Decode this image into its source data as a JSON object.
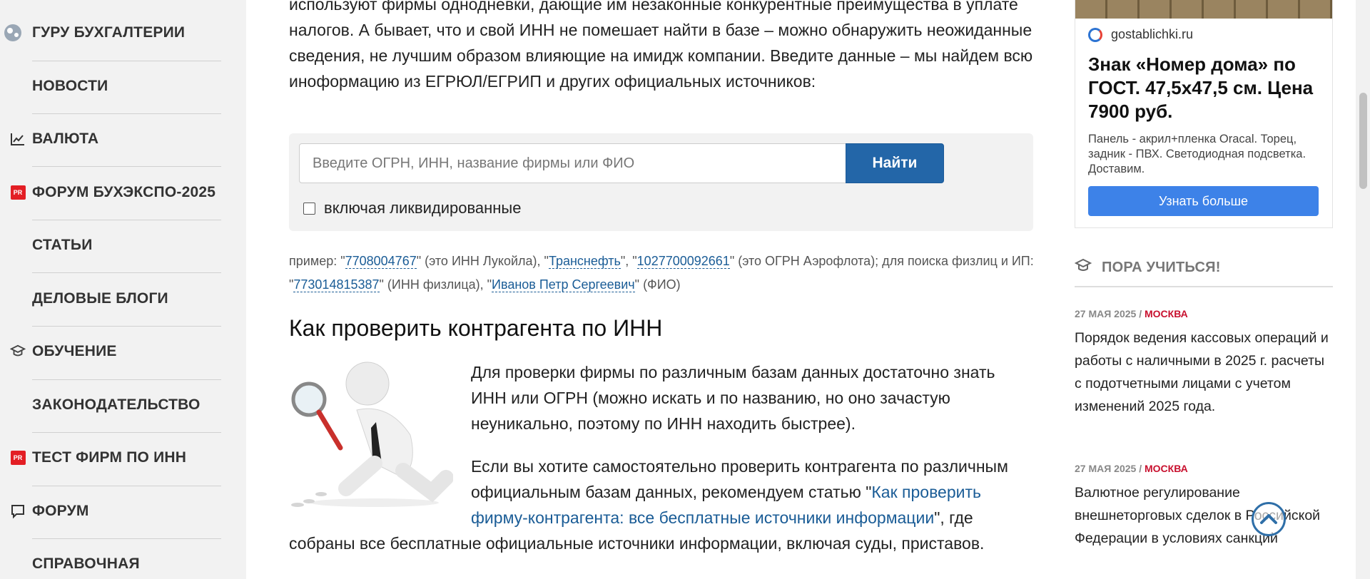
{
  "sidebar": {
    "items": [
      {
        "label": "ГУРУ БУХГАЛТЕРИИ",
        "icon": "guru-icon"
      },
      {
        "label": "НОВОСТИ",
        "icon": ""
      },
      {
        "label": "ВАЛЮТА",
        "icon": "chart-line-icon"
      },
      {
        "label": "ФОРУМ БУХЭКСПО-2025",
        "icon": "pr-badge-icon"
      },
      {
        "label": "СТАТЬИ",
        "icon": ""
      },
      {
        "label": "ДЕЛОВЫЕ БЛОГИ",
        "icon": ""
      },
      {
        "label": "ОБУЧЕНИЕ",
        "icon": "graduation-cap-icon"
      },
      {
        "label": "ЗАКОНОДАТЕЛЬСТВО",
        "icon": ""
      },
      {
        "label": "ТЕСТ ФИРМ ПО ИНН",
        "icon": "pr-badge-icon"
      },
      {
        "label": "ФОРУМ",
        "icon": "chat-icon"
      },
      {
        "label": "СПРАВОЧНАЯ",
        "icon": ""
      }
    ],
    "pr_badge": "PR"
  },
  "main": {
    "intro": "используют фирмы однодневки, дающие им незаконные конкурентные преимущества в уплате налогов. А бывает, что и свой ИНН не помешает найти в базе – можно обнаружить неожиданные сведения, не лучшим образом влияющие на имидж компании. Введите данные – мы найдем всю иноформацию из ЕГРЮЛ/ЕГРИП и других официальных источников:",
    "search": {
      "placeholder": "Введите ОГРН, ИНН, название фирмы или ФИО",
      "button": "Найти",
      "checkbox_label": "включая ликвидированные"
    },
    "examples": {
      "prefix": "пример: \"",
      "ex1": "7708004767",
      "ex1_note": "\" (это ИНН Лукойла), \"",
      "ex2": "Транснефть",
      "ex2_note": "\", \"",
      "ex3": "1027700092661",
      "ex3_note": "\" (это ОГРН Аэрофлота); для поиска физлиц и ИП: \"",
      "ex4": "773014815387",
      "ex4_note": "\" (ИНН физлица), \"",
      "ex5": "Иванов Петр Сергеевич",
      "ex5_note": "\" (ФИО)"
    },
    "heading": "Как проверить контрагента по ИНН",
    "para1": "Для проверки фирмы по различным базам данных достаточно знать ИНН или ОГРН (можно искать и по названию, но оно зачастую неуникально, поэтому по ИНН находить быстрее).",
    "para2_start": "Если вы хотите самостоятельно проверить контрагента по различным официальным базам данных, рекомендуем статью \"",
    "para2_link": "Как проверить фирму-контрагента: все бесплатные источники информации",
    "para2_end": "\", где",
    "para2_tail": "собраны все бесплатные официальные источники информации, включая суды, приставов."
  },
  "ad": {
    "domain": "gostablichki.ru",
    "title": "Знак «Номер дома» по ГОСТ. 47,5х47,5 см. Цена 7900 руб.",
    "description": "Панель - акрил+пленка Oracal. Торец, задник - ПВХ. Светодиодная подсветка. Доставим.",
    "button": "Узнать больше"
  },
  "learn": {
    "title": "ПОРА УЧИТЬСЯ!",
    "news": [
      {
        "date": "27 МАЯ 2025 / ",
        "city": "МОСКВА",
        "title": "Порядок ведения кассовых операций и работы с наличными в 2025 г. расчеты с подотчетными лицами с учетом изменений 2025 года."
      },
      {
        "date": "27 МАЯ 2025 / ",
        "city": "МОСКВА",
        "title": "Валютное регулирование внешнеторговых сделок в Российской Федерации в условиях санкций"
      }
    ]
  },
  "colors": {
    "accent": "#2366a8",
    "link": "#1a5c96",
    "pr": "#e31e24",
    "city": "#c8102e"
  }
}
